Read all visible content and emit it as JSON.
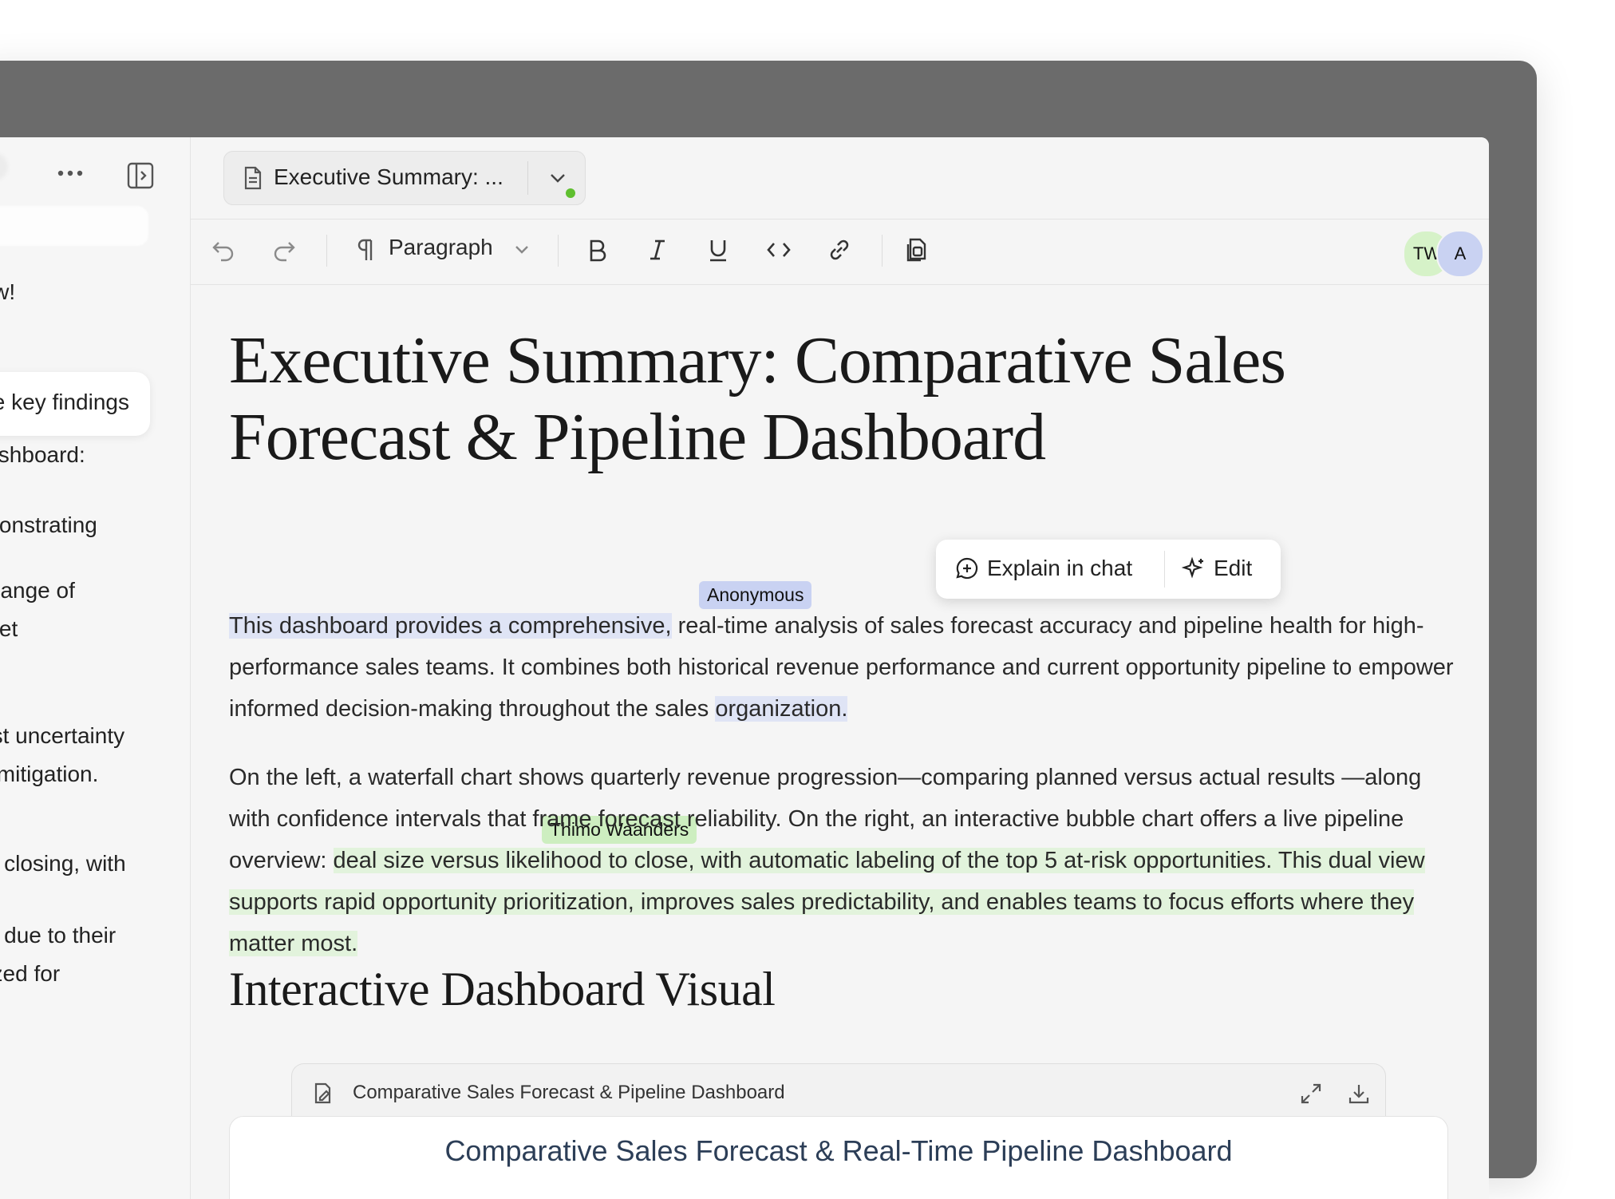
{
  "chat": {
    "lines": [
      "now!",
      "Dashboard:",
      "emonstrating",
      "te range of",
      "meet",
      "cast uncertainty",
      "sk mitigation.",
      "l of closing, with",
      "lip” due to their",
      "ritized for"
    ],
    "bubble_text": "he key findings"
  },
  "document_tab": {
    "title": "Executive Summary: ...",
    "status_color": "#5fbf2f"
  },
  "toolbar": {
    "block_type": "Paragraph",
    "icons": [
      "undo-icon",
      "redo-icon",
      "pilcrow-icon",
      "bold-icon",
      "italic-icon",
      "underline-icon",
      "code-icon",
      "link-icon",
      "copy-document-icon"
    ]
  },
  "collaborators": [
    {
      "initials": "TW",
      "color": "#d6f2c8"
    },
    {
      "initials": "A",
      "color": "#c9d2f2"
    }
  ],
  "document": {
    "title": "Executive Summary: Comparative Sales Forecast & Pipeline Dashboard",
    "para1": {
      "highlight_a": "This dashboard provides a comprehensive,",
      "rest_1": " real-time analysis of sales forecast accuracy and pipeline health for high-performance sales teams. It combines both historical revenue performance and current opportunity pipeline to empower informed decision-making throughout the sales ",
      "highlight_b": "organization.",
      "rest_2": ""
    },
    "para2": {
      "start": "On the left, a waterfall chart shows quarterly revenue progression—comparing planned versus actual results —along with confidence intervals that frame forecast reliability. On the right, an interactive bubble chart offers a live pipeline overview: ",
      "highlight": "deal size versus likelihood to close, with automatic labeling of the top 5 at-risk opportunities. This dual view supports rapid opportunity prioritization, improves sales predictability, and enables teams to focus efforts where they matter most."
    },
    "section_heading": "Interactive Dashboard Visual"
  },
  "cursors": {
    "anonymous": {
      "name": "Anonymous",
      "color": "#c9d2f2"
    },
    "thimo": {
      "name": "Thimo Waanders",
      "color": "#cdeec0"
    }
  },
  "selection_menu": {
    "explain": "Explain in chat",
    "edit": "Edit"
  },
  "artifact": {
    "header": "Comparative Sales Forecast & Pipeline Dashboard",
    "chart_title": "Comparative Sales Forecast & Real-Time Pipeline Dashboard"
  }
}
